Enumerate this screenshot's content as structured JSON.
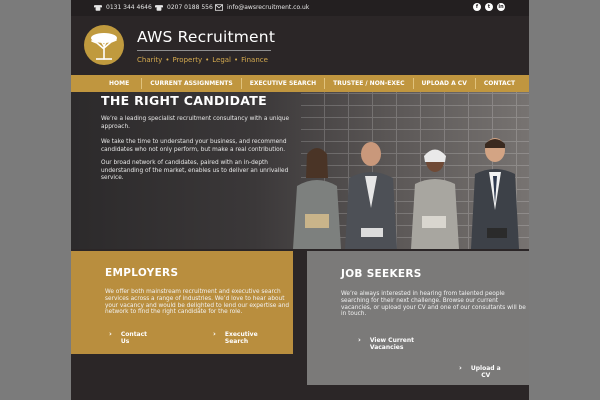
{
  "topbar": {
    "phone1": "0131 344 4646",
    "phone2": "0207 0188 556",
    "email": "info@awsrecruitment.co.uk",
    "social": [
      "f",
      "t",
      "in"
    ]
  },
  "brand": {
    "name": "AWS Recruitment",
    "sectors": [
      "Charity",
      "Property",
      "Legal",
      "Finance"
    ],
    "gold": "#c0963f"
  },
  "nav": {
    "items": [
      "HOME",
      "CURRENT ASSIGNMENTS",
      "EXECUTIVE SEARCH",
      "TRUSTEE / NON-EXEC",
      "UPLOAD A CV",
      "CONTACT"
    ]
  },
  "hero": {
    "title": "THE RIGHT CANDIDATE",
    "p1": "We’re a leading specialist recruitment consultancy with a unique approach.",
    "p2": "We take the time to understand your business, and recommend candidates who not only perform, but make a real contribution.",
    "p3": "Our broad network of candidates, paired with an in-depth understanding of the market, enables us to deliver an unrivalled service."
  },
  "employers": {
    "title": "EMPLOYERS",
    "text": "We offer both mainstream recruitment and executive search services across a range of industries. We’d love to hear about your vacancy and would be delighted to lend our expertise and network to find the right candidate for the role.",
    "cta1_a": "Contact",
    "cta1_b": "Us",
    "cta2_a": "Executive",
    "cta2_b": "Search"
  },
  "seekers": {
    "title": "JOB SEEKERS",
    "text": "We’re always interested in hearing from talented people searching for their next challenge. Browse our current vacancies, or upload your CV and one of our consultants will be in touch.",
    "cta1_a": "View Current",
    "cta1_b": "Vacancies",
    "cta2_a": "Upload a",
    "cta2_b": "CV"
  }
}
